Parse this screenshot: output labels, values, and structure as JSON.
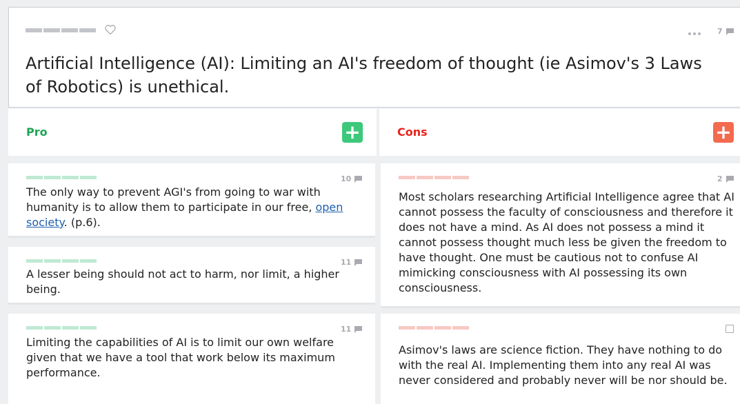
{
  "header": {
    "title": "Artificial Intelligence (AI): Limiting an AI's freedom of thought (ie Asimov's 3 Laws of Robotics) is unethical.",
    "comment_count": "7"
  },
  "pro": {
    "label": "Pro",
    "add_label": "+",
    "color": "#1ca654",
    "btn_color": "#3dc87b",
    "tag_color": "#bfe9d4",
    "cards": [
      {
        "count": "10",
        "text_before": "The only way to prevent AGI's from going to war with humanity is to allow them to participate in our free, ",
        "link": "open society",
        "text_after": ". (p.6)."
      },
      {
        "count": "11",
        "text": "A lesser being should not act to harm, nor limit, a higher being."
      },
      {
        "count": "11",
        "text": "Limiting the capabilities of AI is to limit our own welfare given that we have a tool that work below its maximum performance."
      }
    ]
  },
  "cons": {
    "label": "Cons",
    "add_label": "+",
    "color": "#e8241c",
    "btn_color": "#f36a4f",
    "tag_color": "#f7c9c3",
    "cards": [
      {
        "count": "2",
        "text": "Most scholars researching Artificial Intelligence agree that AI cannot possess the faculty of consciousness and therefore it does not have a mind. As AI does not possess a mind it cannot possess thought much less be given the freedom to have thought. One must be cautious not to confuse AI mimicking consciousness with AI possessing its own consciousness."
      },
      {
        "count": "",
        "text": "Asimov's laws are science fiction. They have nothing to do with the real AI. Implementing them into any real AI was never considered and probably never will be nor should be."
      }
    ]
  }
}
